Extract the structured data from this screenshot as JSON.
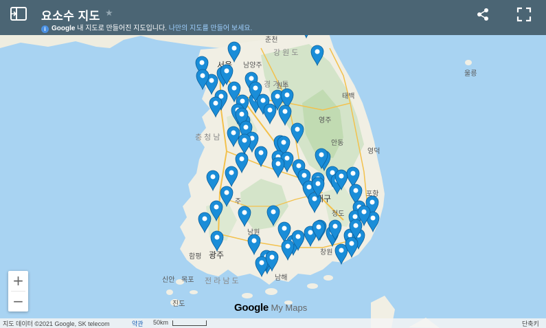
{
  "header": {
    "title": "요소수 지도",
    "subtitle_brand": "Google",
    "subtitle_text": " 내 지도로 만들어진 지도입니다.",
    "subtitle_link": "나만의 지도를 만들어 보세요.",
    "info_glyph": "i",
    "star_glyph": "★"
  },
  "zoom": {
    "in_label": "+",
    "out_label": "−"
  },
  "branding": {
    "google": "Google",
    "mymaps": " My Maps"
  },
  "footer": {
    "attribution": "지도 데이터 ©2021 Google, SK telecom",
    "terms": "약관",
    "scale": "50km",
    "shortcuts": "단축키"
  },
  "place_labels": {
    "chuncheon": "춘천",
    "gangwon": "강 원 도",
    "seoul": "서울",
    "namyangju": "남양주",
    "ulleung": "울릉",
    "wonju": "원주",
    "taebaek": "태백",
    "gyeonggi": "경 기 도",
    "chungbuk": "충 청 남",
    "yeongju": "영주",
    "andong": "안동",
    "yeongdeok": "영덕",
    "pohang": "포항",
    "daegu": "대구",
    "cheongdo": "청도",
    "namwon": "남원",
    "changwon": "창원",
    "gwangju": "광주",
    "hampyeong": "함평",
    "sinan": "신안",
    "mokpo": "목포",
    "jeonnam": "전 라 남 도",
    "namhae": "남해",
    "jindo": "진도",
    "jeonju": "주",
    "mokcheon": "목"
  },
  "markers": {
    "count": 100,
    "color": "#1a8dd8"
  },
  "colors": {
    "header_bg": "#4b6574",
    "sea": "#a8d3f2",
    "land": "#f1efe4",
    "pin": "#1a8dd8"
  }
}
